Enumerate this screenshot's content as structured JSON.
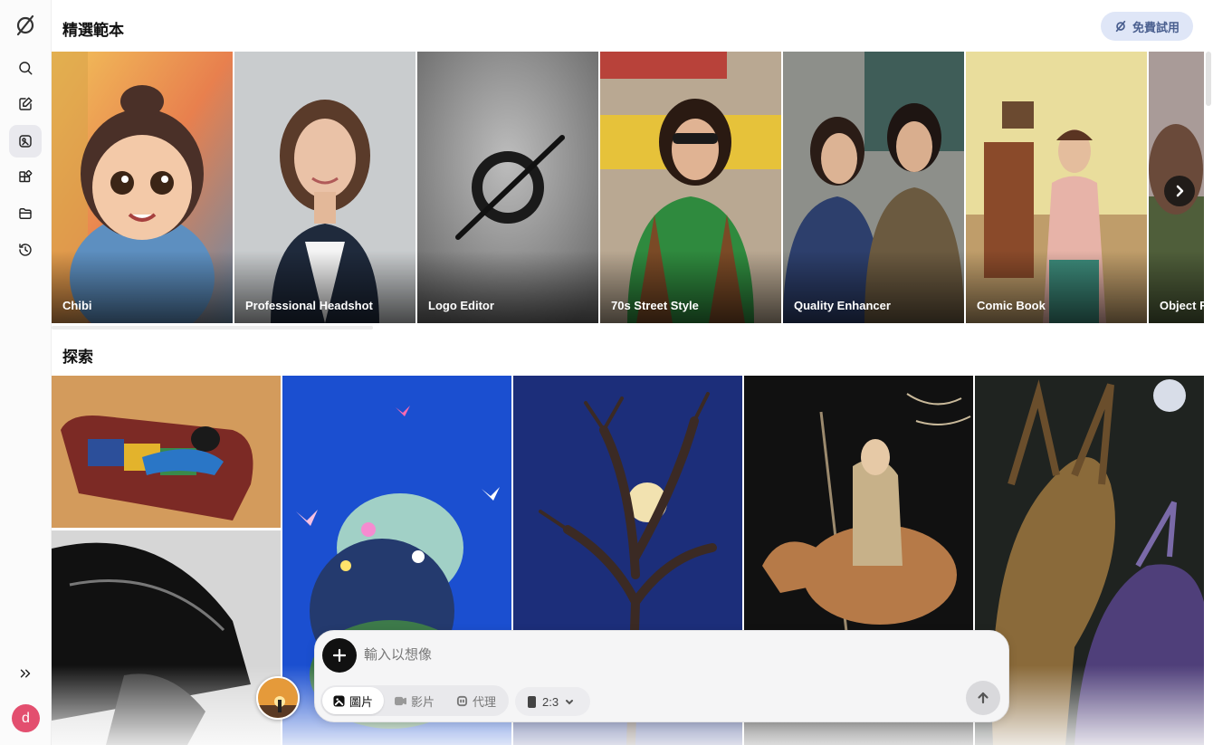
{
  "sidebar": {
    "logo": "slashed-circle-logo",
    "items": [
      {
        "name": "search",
        "icon": "search-icon"
      },
      {
        "name": "edit",
        "icon": "edit-icon"
      },
      {
        "name": "templates",
        "icon": "templates-icon",
        "active": true
      },
      {
        "name": "apps",
        "icon": "apps-icon"
      },
      {
        "name": "folder",
        "icon": "folder-icon"
      },
      {
        "name": "history",
        "icon": "history-icon"
      }
    ],
    "expand_icon": "double-chevron-right-icon",
    "user_initial": "d",
    "user_color": "#e34f6f"
  },
  "featured": {
    "title": "精選範本",
    "trial_label": "免費試用",
    "cards": [
      {
        "label": "Chibi"
      },
      {
        "label": "Professional Headshot"
      },
      {
        "label": "Logo Editor"
      },
      {
        "label": "70s Street Style"
      },
      {
        "label": "Quality Enhancer"
      },
      {
        "label": "Comic Book"
      },
      {
        "label": "Object Removal"
      }
    ]
  },
  "explore": {
    "title": "探索"
  },
  "composer": {
    "placeholder": "輸入以想像",
    "modes": [
      {
        "label": "圖片",
        "icon": "image-icon",
        "active": true
      },
      {
        "label": "影片",
        "icon": "video-icon"
      },
      {
        "label": "代理",
        "icon": "agent-icon"
      }
    ],
    "ratio": "2:3"
  },
  "colors": {
    "accent_bg": "#dfe6f7",
    "accent_text": "#4a5f8f",
    "send_bg": "#d9d9dc"
  }
}
